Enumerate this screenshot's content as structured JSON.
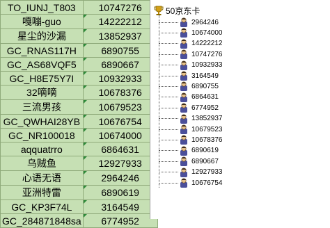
{
  "sheet": {
    "rows": [
      {
        "name": "TO_IUNJ_T803",
        "id": "10747276",
        "flag": false
      },
      {
        "name": "嘎嘣-guo",
        "id": "14222212",
        "flag": true
      },
      {
        "name": "星尘的沙漏",
        "id": "13852937",
        "flag": true
      },
      {
        "name": "GC_RNAS117H",
        "id": "6890755",
        "flag": true
      },
      {
        "name": "GC_AS68VQF5",
        "id": "6890667",
        "flag": true
      },
      {
        "name": "GC_H8E75Y7I",
        "id": "10932933",
        "flag": true
      },
      {
        "name": "32嘀嘀",
        "id": "10678376",
        "flag": true
      },
      {
        "name": "三流男孩",
        "id": "10679523",
        "flag": true
      },
      {
        "name": "GC_QWHAI28YB",
        "id": "10676754",
        "flag": true
      },
      {
        "name": "GC_NR100018",
        "id": "10674000",
        "flag": true
      },
      {
        "name": "aqquatrro",
        "id": "6864631",
        "flag": true
      },
      {
        "name": "乌贼鱼",
        "id": "12927933",
        "flag": true
      },
      {
        "name": "心语无语",
        "id": "2964246",
        "flag": true
      },
      {
        "name": "亚洲特雷",
        "id": "6890619",
        "flag": true
      },
      {
        "name": "GC_KP3F74L",
        "id": "3164549",
        "flag": true
      },
      {
        "name": "GC_284871848sa",
        "id": "6774952",
        "flag": true
      }
    ]
  },
  "tree": {
    "root_label": "50京东卡",
    "root_icon": "trophy-icon",
    "node_icon": "user-icon",
    "items": [
      "2964246",
      "10674000",
      "14222212",
      "10747276",
      "10932933",
      "3164549",
      "6890755",
      "6864631",
      "6774952",
      "13852937",
      "10679523",
      "10678376",
      "6890619",
      "6890667",
      "12927933",
      "10676754"
    ]
  }
}
